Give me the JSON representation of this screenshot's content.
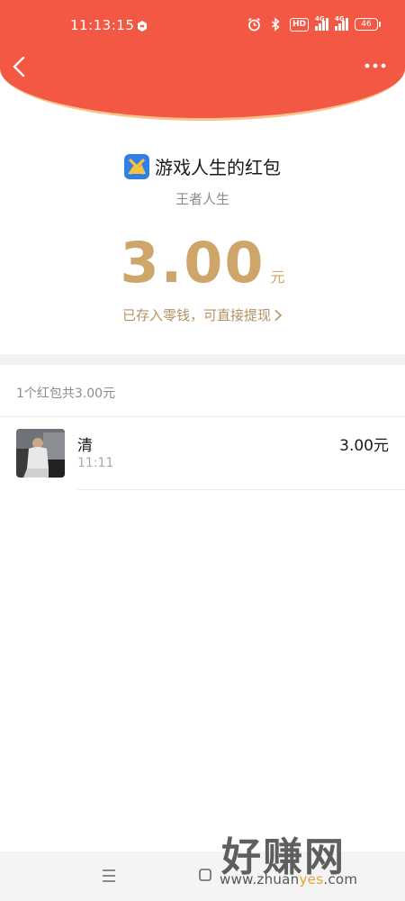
{
  "status_bar": {
    "time": "11:13:15",
    "hd_badge": "HD",
    "network_1": "4G",
    "network_2": "4G",
    "battery": "46"
  },
  "header": {
    "back_icon": "chevron-left-icon",
    "more_icon": "more-dots-icon",
    "accent_color": "#f25844",
    "trim_color": "#f6c48a"
  },
  "red_packet": {
    "title": "游戏人生的红包",
    "sender_subtitle": "王者人生",
    "amount": "3.00",
    "currency": "元",
    "saved_note": "已存入零钱，可直接提现",
    "amount_color": "#cfa66a"
  },
  "receipts": {
    "summary": "1个红包共3.00元",
    "items": [
      {
        "name": "清",
        "time": "11:11",
        "amount": "3.00元"
      }
    ]
  },
  "nav_bar": {
    "menu_icon": "menu-icon",
    "home_icon": "home-square-icon"
  },
  "watermark": {
    "brand": "好赚网",
    "url_prefix": "www.zhuan",
    "url_accent": "yes",
    "url_suffix": ".com"
  }
}
